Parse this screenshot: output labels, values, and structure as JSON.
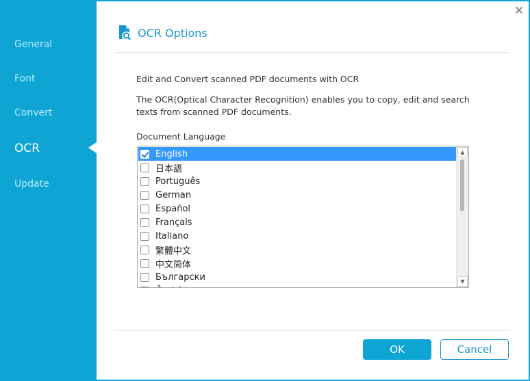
{
  "sidebar": {
    "items": [
      {
        "label": "General",
        "active": false
      },
      {
        "label": "Font",
        "active": false
      },
      {
        "label": "Convert",
        "active": false
      },
      {
        "label": "OCR",
        "active": true
      },
      {
        "label": "Update",
        "active": false
      }
    ]
  },
  "header": {
    "icon": "document-search-icon",
    "title": "OCR Options"
  },
  "close_icon": "✕",
  "content": {
    "subtitle": "Edit and Convert scanned PDF documents with OCR",
    "description_line1": "The OCR(Optical Character Recognition) enables you to copy, edit and search",
    "description_line2": "texts from scanned PDF documents.",
    "language_label": "Document Language"
  },
  "languages": [
    {
      "label": "English",
      "checked": true,
      "selected": true
    },
    {
      "label": "日本語",
      "checked": false
    },
    {
      "label": "Português",
      "checked": false
    },
    {
      "label": "German",
      "checked": false
    },
    {
      "label": "Español",
      "checked": false
    },
    {
      "label": "Français",
      "checked": false
    },
    {
      "label": "Italiano",
      "checked": false
    },
    {
      "label": "繁體中文",
      "checked": false
    },
    {
      "label": "中文简体",
      "checked": false
    },
    {
      "label": "Български",
      "checked": false
    },
    {
      "label": "Český",
      "checked": false
    }
  ],
  "scrollbar": {
    "up": "▲",
    "down": "▼"
  },
  "buttons": {
    "ok": "OK",
    "cancel": "Cancel"
  },
  "colors": {
    "accent": "#0ea5d5",
    "selection": "#3399ff",
    "title": "#1a95cd"
  }
}
